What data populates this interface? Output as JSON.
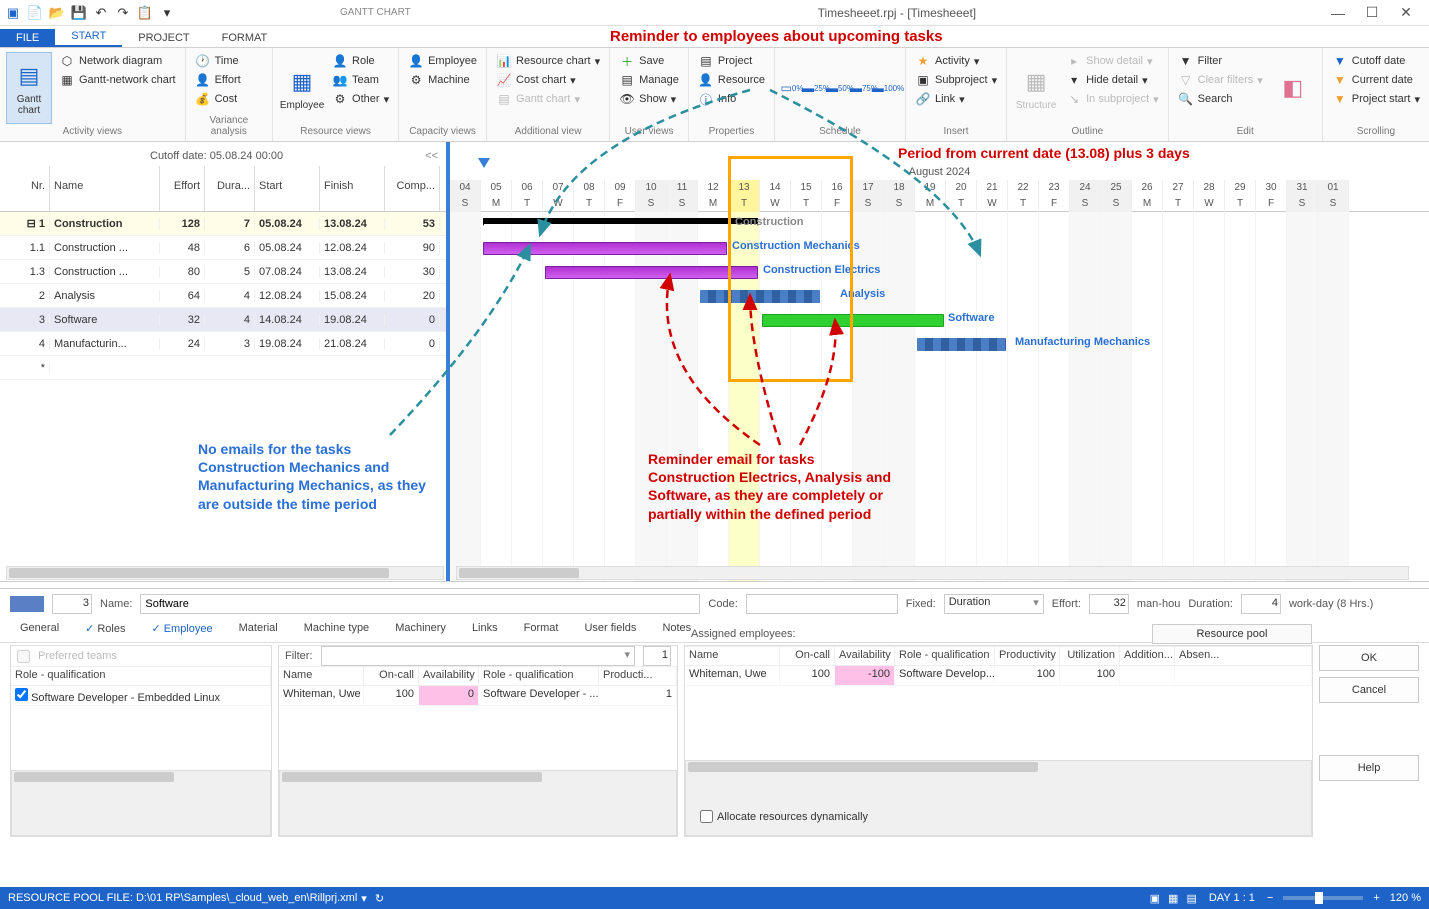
{
  "window": {
    "title": "Timesheeet.rpj - [Timesheeet]",
    "gantt_tab": "GANTT CHART"
  },
  "ribbon_tabs": {
    "file": "FILE",
    "start": "START",
    "project": "PROJECT",
    "format": "FORMAT"
  },
  "ribbon": {
    "activity_views": {
      "label": "Activity views",
      "gantt": "Gantt chart",
      "network": "Network diagram",
      "ganttnet": "Gantt-network chart"
    },
    "variance": {
      "label": "Variance analysis",
      "time": "Time",
      "effort": "Effort",
      "cost": "Cost"
    },
    "resource": {
      "label": "Resource views",
      "employee": "Employee",
      "role": "Role",
      "team": "Team",
      "other": "Other"
    },
    "capacity": {
      "label": "Capacity views",
      "employee": "Employee",
      "machine": "Machine"
    },
    "additional": {
      "label": "Additional view",
      "reschart": "Resource chart",
      "costchart": "Cost chart",
      "ganttchart": "Gantt chart"
    },
    "userviews": {
      "label": "User views",
      "save": "Save",
      "manage": "Manage",
      "show": "Show"
    },
    "properties": {
      "label": "Properties",
      "project": "Project",
      "resource": "Resource",
      "info": "Info"
    },
    "schedule": {
      "label": "Schedule"
    },
    "insert": {
      "label": "Insert",
      "activity": "Activity",
      "subproject": "Subproject",
      "link": "Link"
    },
    "outline": {
      "label": "Outline",
      "structure": "Structure",
      "showdetail": "Show detail",
      "hidedetail": "Hide detail",
      "insub": "In subproject"
    },
    "edit": {
      "label": "Edit",
      "filter": "Filter",
      "clear": "Clear filters",
      "search": "Search"
    },
    "scrolling": {
      "label": "Scrolling",
      "cutoff": "Cutoff date",
      "current": "Current date",
      "pstart": "Project start"
    }
  },
  "annotations": {
    "title": "Reminder to employees about upcoming tasks",
    "period": "Period from current date (13.08) plus 3 days",
    "noemail": "No emails for the tasks Construction Mechanics and Manufacturing Mechanics, as they are outside the time period",
    "reminder": "Reminder email for tasks Construction Electrics, Analysis and Software, as they are completely or partially within the defined period"
  },
  "cutoff": "Cutoff date: 05.08.24 00:00",
  "task_cols": {
    "nr": "Nr.",
    "name": "Name",
    "effort": "Effort",
    "dura": "Dura...",
    "start": "Start",
    "finish": "Finish",
    "comp": "Comp..."
  },
  "tasks": [
    {
      "nr": "1",
      "name": "Construction",
      "effort": "128",
      "dura": "7",
      "start": "05.08.24",
      "finish": "13.08.24",
      "comp": "53",
      "summary": true
    },
    {
      "nr": "1.1",
      "name": "Construction ...",
      "effort": "48",
      "dura": "6",
      "start": "05.08.24",
      "finish": "12.08.24",
      "comp": "90"
    },
    {
      "nr": "1.3",
      "name": "Construction ...",
      "effort": "80",
      "dura": "5",
      "start": "07.08.24",
      "finish": "13.08.24",
      "comp": "30"
    },
    {
      "nr": "2",
      "name": "Analysis",
      "effort": "64",
      "dura": "4",
      "start": "12.08.24",
      "finish": "15.08.24",
      "comp": "20"
    },
    {
      "nr": "3",
      "name": "Software",
      "effort": "32",
      "dura": "4",
      "start": "14.08.24",
      "finish": "19.08.24",
      "comp": "0",
      "selected": true
    },
    {
      "nr": "4",
      "name": "Manufacturin...",
      "effort": "24",
      "dura": "3",
      "start": "19.08.24",
      "finish": "21.08.24",
      "comp": "0"
    }
  ],
  "gantt": {
    "month": "August 2024",
    "days": [
      "04",
      "05",
      "06",
      "07",
      "08",
      "09",
      "10",
      "11",
      "12",
      "13",
      "14",
      "15",
      "16",
      "17",
      "18",
      "19",
      "20",
      "21",
      "22",
      "23",
      "24",
      "25",
      "26",
      "27",
      "28",
      "29",
      "30",
      "31",
      "01"
    ],
    "dows": [
      "S",
      "M",
      "T",
      "W",
      "T",
      "F",
      "S",
      "S",
      "M",
      "T",
      "W",
      "T",
      "F",
      "S",
      "S",
      "M",
      "T",
      "W",
      "T",
      "F",
      "S",
      "S",
      "M",
      "T",
      "W",
      "T",
      "F",
      "S",
      "S"
    ],
    "bars": [
      {
        "label": "Construction",
        "labelColor": "#888"
      },
      {
        "label": "Construction Mechanics",
        "labelColor": "#2a6fd6"
      },
      {
        "label": "Construction Electrics",
        "labelColor": "#2a6fd6"
      },
      {
        "label": "Analysis",
        "labelColor": "#2a6fd6"
      },
      {
        "label": "Software",
        "labelColor": "#2a6fd6"
      },
      {
        "label": "Manufacturing Mechanics",
        "labelColor": "#2a6fd6"
      }
    ]
  },
  "detail": {
    "id": "3",
    "name_label": "Name:",
    "name_value": "Software",
    "code_label": "Code:",
    "code_value": "",
    "fixed_label": "Fixed:",
    "fixed_value": "Duration",
    "effort_label": "Effort:",
    "effort_value": "32",
    "effort_unit": "man-hou",
    "dur_label": "Duration:",
    "dur_value": "4",
    "dur_unit": "work-day (8 Hrs.)",
    "tabs": {
      "general": "General",
      "roles": "Roles",
      "employee": "Employee",
      "material": "Material",
      "machine": "Machine type",
      "machinery": "Machinery",
      "links": "Links",
      "format": "Format",
      "user": "User fields",
      "notes": "Notes"
    },
    "pref_teams": "Preferred teams",
    "filter_label": "Filter:",
    "filter_count": "1",
    "assigned_label": "Assigned employees:",
    "pool_btn": "Resource pool",
    "role_head": "Role - qualification",
    "role_item": "Software Developer - Embedded Linux",
    "mid_cols": {
      "name": "Name",
      "oncall": "On-call",
      "avail": "Availability",
      "role": "Role - qualification",
      "prod": "Producti..."
    },
    "mid_row": {
      "name": "Whiteman, Uwe",
      "oncall": "100",
      "avail": "0",
      "role": "Software Developer - ...",
      "prod": "1"
    },
    "right_cols": {
      "name": "Name",
      "oncall": "On-call",
      "avail": "Availability",
      "role": "Role - qualification",
      "prod": "Productivity",
      "util": "Utilization",
      "add": "Addition...",
      "abs": "Absen..."
    },
    "right_row": {
      "name": "Whiteman, Uwe",
      "oncall": "100",
      "avail": "-100",
      "role": "Software Develop...",
      "prod": "100",
      "util": "100"
    },
    "allocate": "Allocate resources dynamically",
    "ok": "OK",
    "cancel": "Cancel",
    "help": "Help"
  },
  "status": {
    "file": "RESOURCE POOL FILE: D:\\01 RP\\Samples\\_cloud_web_en\\Rillprj.xml",
    "day": "DAY 1 : 1",
    "zoom": "120 %"
  }
}
